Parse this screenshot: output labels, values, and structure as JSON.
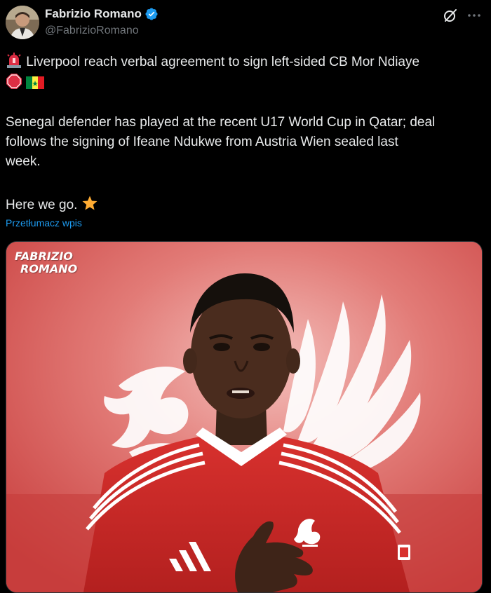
{
  "author": {
    "name": "Fabrizio Romano",
    "handle": "@FabrizioRomano",
    "verified": true
  },
  "tweet": {
    "line1": "Liverpool reach verbal agreement to sign left-sided CB Mor Ndiaye",
    "para2_line1": "Senegal defender has played at the recent U17 World Cup in Qatar; deal",
    "para2_line2": "follows the signing of Ifeane Ndukwe from Austria Wien sealed last",
    "para2_line3": "week.",
    "para3": "Here we go.",
    "emojis": [
      "rotating-light-emoji",
      "stop-sign-emoji",
      "senegal-flag-emoji",
      "star-emoji"
    ]
  },
  "translate_link": "Przetłumacz wpis",
  "media": {
    "watermark_line1": "FABRIZIO",
    "watermark_line2": "ROMANO",
    "description_icons": [
      "liverpool-liverbird-crest",
      "adidas-logo"
    ]
  },
  "colors": {
    "background": "#000000",
    "text": "#e7e9ea",
    "secondary_text": "#71767b",
    "link": "#1d9bf0",
    "verified": "#1d9bf0",
    "media_red": "#d65a5a"
  },
  "icons": [
    "grok-icon",
    "more-icon",
    "verified-badge-icon"
  ]
}
